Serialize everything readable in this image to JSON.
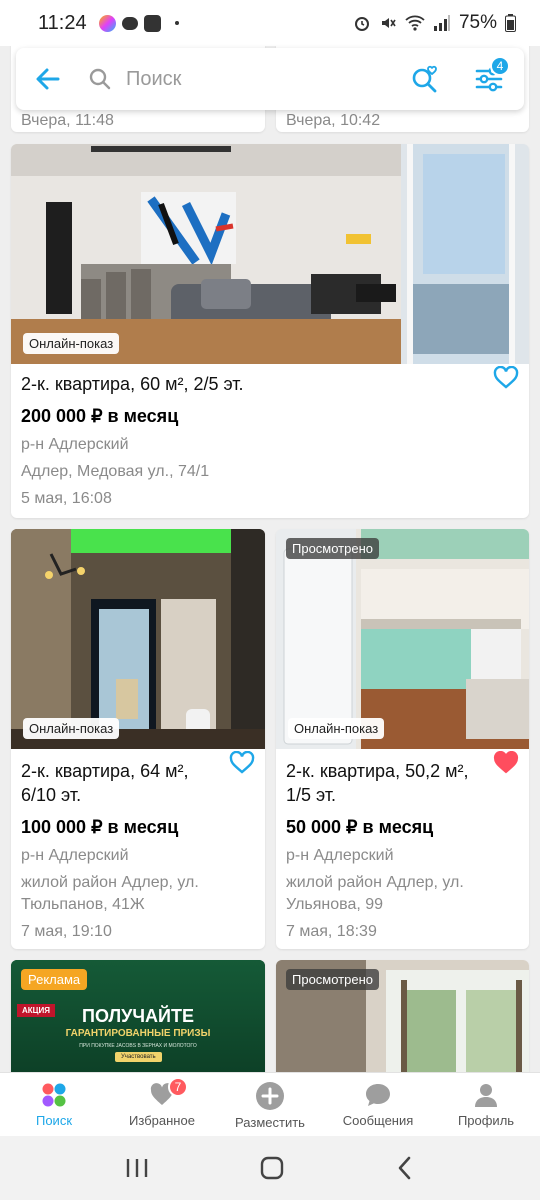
{
  "status_bar": {
    "time": "11:24",
    "battery": "75%"
  },
  "search": {
    "placeholder": "Поиск",
    "filter_count": "4"
  },
  "prev_row": {
    "left_date": "Вчера, 11:48",
    "right_date": "Вчера, 10:42"
  },
  "listings": [
    {
      "badge": "Онлайн-показ",
      "title": "2-к. квартира, 60 м², 2/5 эт.",
      "price": "200 000 ₽ в месяц",
      "district": "р-н Адлерский",
      "address": "Адлер, Медовая ул., 74/1",
      "date": "5 мая, 16:08",
      "favorite": false
    },
    {
      "badge": "Онлайн-показ",
      "title": "2-к. квартира, 64 м², 6/10 эт.",
      "price": "100 000 ₽ в месяц",
      "district": "р-н Адлерский",
      "address": "жилой район Адлер, ул. Тюльпанов, 41Ж",
      "date": "7 мая, 19:10",
      "favorite": false
    },
    {
      "viewed": "Просмотрено",
      "badge": "Онлайн-показ",
      "title": "2-к. квартира, 50,2 м², 1/5 эт.",
      "price": "50 000 ₽ в месяц",
      "district": "р-н Адлерский",
      "address": "жилой район Адлер, ул. Ульянова, 99",
      "date": "7 мая, 18:39",
      "favorite": true
    }
  ],
  "ad": {
    "label": "Реклама",
    "promo_tag": "АКЦИЯ",
    "headline": "ПОЛУЧАЙТЕ",
    "subheadline": "ГАРАНТИРОВАННЫЕ ПРИЗЫ",
    "fineprint": "ПРИ ПОКУПКЕ JACOBS В ЗЕРНАХ И МОЛОТОГО",
    "cta": "Участвовать"
  },
  "next_card": {
    "viewed": "Просмотрено"
  },
  "bottom_nav": [
    {
      "label": "Поиск",
      "icon": "search-dots-icon",
      "active": true
    },
    {
      "label": "Избранное",
      "icon": "heart-icon",
      "badge": "7"
    },
    {
      "label": "Разместить",
      "icon": "plus-icon"
    },
    {
      "label": "Сообщения",
      "icon": "chat-icon"
    },
    {
      "label": "Профиль",
      "icon": "person-icon"
    }
  ],
  "colors": {
    "accent": "#1ea7e8",
    "favorite": "#ff4d5e",
    "ad_badge": "#f5a623"
  }
}
